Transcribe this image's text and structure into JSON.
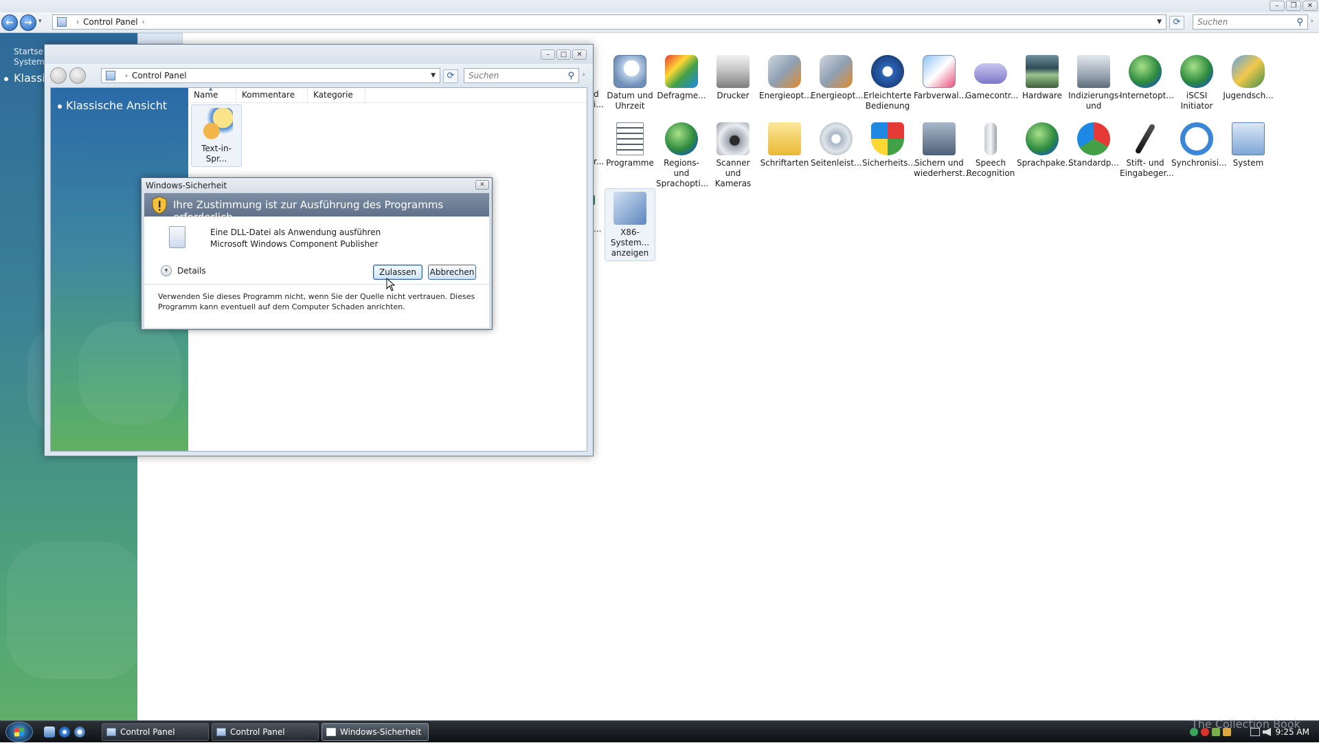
{
  "outer_window": {
    "address": {
      "segments": [
        "Control Panel"
      ]
    },
    "search": {
      "placeholder": "Suchen"
    },
    "sidebar": {
      "home_label": "Startseite\nSystems",
      "classic_view": "Klassi"
    },
    "columns_hidden": [
      "Name",
      "Kommentare",
      "Kategorie"
    ],
    "partial_labels": [
      "d\ni...",
      "r..."
    ],
    "items": [
      {
        "label": "Datum und Uhrzeit",
        "icon": "clock-calendar-icon"
      },
      {
        "label": "Defragme...",
        "icon": "defrag-icon"
      },
      {
        "label": "Drucker",
        "icon": "printer-icon"
      },
      {
        "label": "Energieopt...",
        "icon": "power-options-icon"
      },
      {
        "label": "Energieopt...",
        "icon": "power-options-icon"
      },
      {
        "label": "Erleichterte Bedienung",
        "icon": "ease-of-access-icon"
      },
      {
        "label": "Farbverwal...",
        "icon": "color-management-icon"
      },
      {
        "label": "Gamecontr...",
        "icon": "game-controller-icon"
      },
      {
        "label": "Hardware",
        "icon": "hardware-icon"
      },
      {
        "label": "Indizierungs- und",
        "icon": "indexing-icon"
      },
      {
        "label": "Internetopt...",
        "icon": "internet-options-icon"
      },
      {
        "label": "iSCSI Initiator",
        "icon": "iscsi-icon"
      },
      {
        "label": "Jugendsch...",
        "icon": "parental-controls-icon"
      },
      {
        "label": "Programme",
        "icon": "programs-icon"
      },
      {
        "label": "Regions- und Sprachopti...",
        "icon": "regional-globe-icon"
      },
      {
        "label": "Scanner und Kameras",
        "icon": "scanner-camera-icon"
      },
      {
        "label": "Schriftarten",
        "icon": "fonts-folder-icon"
      },
      {
        "label": "Seitenleist...",
        "icon": "sidebar-gear-icon"
      },
      {
        "label": "Sicherheits...",
        "icon": "security-shield-icon"
      },
      {
        "label": "Sichern und wiederherst...",
        "icon": "backup-icon"
      },
      {
        "label": "Speech Recognition",
        "icon": "microphone-icon"
      },
      {
        "label": "Sprachpake...",
        "icon": "language-pack-icon"
      },
      {
        "label": "Standardp...",
        "icon": "default-programs-icon"
      },
      {
        "label": "Stift- und Eingabeger...",
        "icon": "pen-icon"
      },
      {
        "label": "Synchronisi...",
        "icon": "sync-icon"
      },
      {
        "label": "System",
        "icon": "system-icon"
      },
      {
        "label": "X86-System... anzeigen",
        "icon": "x86-system-icon"
      }
    ]
  },
  "inner_window": {
    "address": {
      "segments": [
        "Control Panel"
      ]
    },
    "search": {
      "placeholder": "Suchen"
    },
    "sidebar": {
      "classic_view": "Klassische Ansicht"
    },
    "columns": [
      "Name",
      "Kommentare",
      "Kategorie"
    ],
    "items": [
      {
        "label": "Text-in-Spr...",
        "icon": "text-to-speech-icon"
      }
    ]
  },
  "uac_dialog": {
    "title": "Windows-Sicherheit",
    "heading": "Ihre Zustimmung ist zur Ausführung des Programms erforderlich",
    "program_name": "Eine DLL-Datei als Anwendung ausführen",
    "publisher": "Microsoft Windows Component Publisher",
    "details_label": "Details",
    "allow_button": "Zulassen",
    "cancel_button": "Abbrechen",
    "footer": "Verwenden Sie dieses Programm nicht, wenn Sie der Quelle nicht vertrauen. Dieses Programm kann eventuell auf dem Computer Schaden anrichten."
  },
  "taskbar": {
    "buttons": [
      "Control Panel",
      "Control Panel",
      "Windows-Sicherheit"
    ],
    "clock": "9:25 AM",
    "watermark": "The Collection Book"
  },
  "colors": {
    "uac_banner": "#6f8098",
    "sidebar_blue": "#2a6aa8",
    "sidebar_green": "#61b063",
    "taskbar": "#1a1e22"
  }
}
